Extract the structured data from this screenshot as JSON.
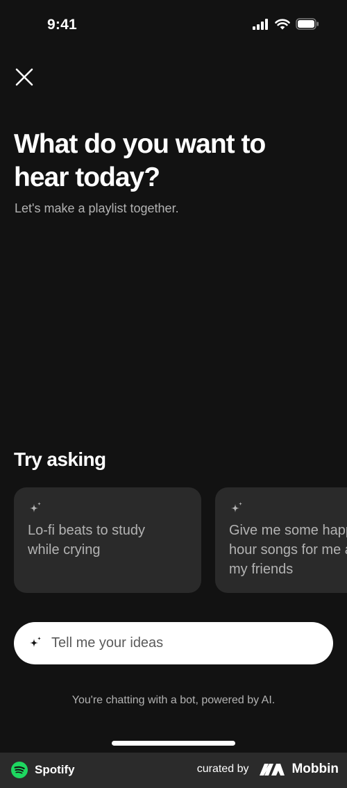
{
  "status_bar": {
    "time": "9:41",
    "icons": [
      "cellular-signal-icon",
      "wifi-icon",
      "battery-icon"
    ]
  },
  "header": {
    "close_icon": "close-icon",
    "title": "What do you want to hear today?",
    "subtitle": "Let's make a playlist together."
  },
  "try_asking": {
    "heading": "Try asking",
    "suggestions": [
      {
        "icon": "sparkle-icon",
        "text": "Lo-fi beats to study\nwhile crying"
      },
      {
        "icon": "sparkle-icon",
        "text": "Give me some happy\nhour songs for me and\nmy friends"
      }
    ]
  },
  "prompt_input": {
    "icon": "sparkle-icon",
    "value": "",
    "placeholder": "Tell me your ideas"
  },
  "disclaimer": "You're chatting with a bot, powered by AI.",
  "footer": {
    "app_name": "Spotify",
    "curated_by": "curated by",
    "brand": "Mobbin"
  },
  "colors": {
    "background": "#121212",
    "card": "#2a2a2a",
    "text_primary": "#ffffff",
    "text_secondary": "#b3b3b3",
    "spotify_green": "#1ed760",
    "footer_bg": "#2b2b2b"
  }
}
